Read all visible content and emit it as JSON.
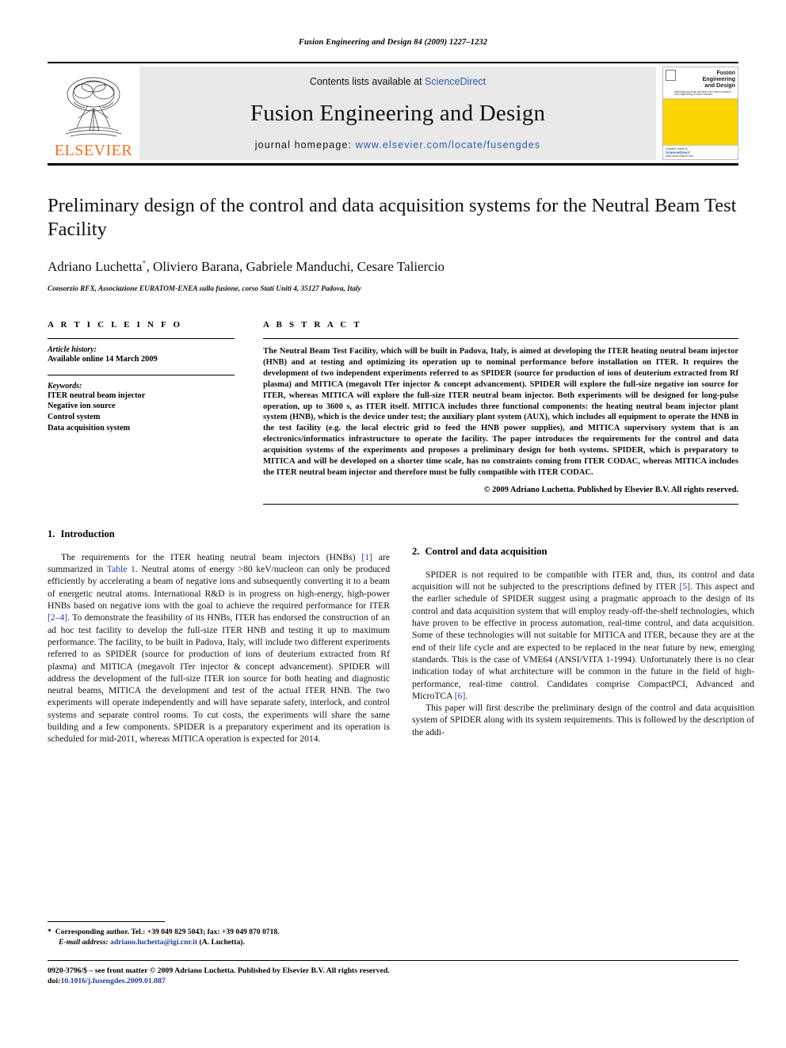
{
  "running_head": "Fusion Engineering and Design 84 (2009) 1227–1232",
  "masthead": {
    "publisher": "ELSEVIER",
    "contents_prefix": "Contents lists available at ",
    "contents_link": "ScienceDirect",
    "journal_name": "Fusion Engineering and Design",
    "homepage_prefix": "journal homepage: ",
    "homepage_url": "www.elsevier.com/locate/fusengdes",
    "cover": {
      "title_line1": "Fusion Engineering",
      "title_line2": "and Design",
      "subtitle": "International journal devoted to the fusion research and engineering of fusion reactors",
      "bottom_text": "Available online at",
      "bottom_mark": "ScienceDirect",
      "bottom_url": "www.sciencedirect.com"
    },
    "accent_orange": "#f27021",
    "cover_yellow": "#fbd603",
    "link_blue": "#2b59a8"
  },
  "article": {
    "title": "Preliminary design of the control and data acquisition systems for the Neutral Beam Test Facility",
    "authors": "Adriano Luchetta",
    "authors_rest": ", Oliviero Barana, Gabriele Manduchi, Cesare Taliercio",
    "corresponding_mark": "*",
    "affiliation": "Consorzio RFX, Associazione EURATOM-ENEA sulla fusione, corso Stati Uniti 4, 35127 Padova, Italy"
  },
  "article_info": {
    "heading": "A R T I C L E  I N F O",
    "history_label": "Article history:",
    "history_value": "Available online 14 March 2009",
    "keywords_label": "Keywords:",
    "keywords": [
      "ITER neutral beam injector",
      "Negative ion source",
      "Control system",
      "Data acquisition system"
    ]
  },
  "abstract": {
    "heading": "A B S T R A C T",
    "text": "The Neutral Beam Test Facility, which will be built in Padova, Italy, is aimed at developing the ITER heating neutral beam injector (HNB) and at testing and optimizing its operation up to nominal performance before installation on ITER. It requires the development of two independent experiments referred to as SPIDER (source for production of ions of deuterium extracted from Rf plasma) and MITICA (megavolt ITer injector & concept advancement). SPIDER will explore the full-size negative ion source for ITER, whereas MITICA will explore the full-size ITER neutral beam injector. Both experiments will be designed for long-pulse operation, up to 3600 s, as ITER itself. MITICA includes three functional components: the heating neutral beam injector plant system (HNB), which is the device under test; the auxiliary plant system (AUX), which includes all equipment to operate the HNB in the test facility (e.g. the local electric grid to feed the HNB power supplies), and MITICA supervisory system that is an electronics/informatics infrastructure to operate the facility. The paper introduces the requirements for the control and data acquisition systems of the experiments and proposes a preliminary design for both systems. SPIDER, which is preparatory to MITICA and will be developed on a shorter time scale, has no constraints coming from ITER CODAC, whereas MITICA includes the ITER neutral beam injector and therefore must be fully compatible with ITER CODAC.",
    "copyright": "© 2009 Adriano Luchetta. Published by Elsevier B.V. All rights reserved."
  },
  "body": {
    "section1_num": "1.",
    "section1_title": "Introduction",
    "p1_a": "The requirements for the ITER heating neutral beam injectors (HNBs) ",
    "p1_ref1": "[1]",
    "p1_b": " are summarized in ",
    "p1_table": "Table 1",
    "p1_c": ". Neutral atoms of energy >80 keV/nucleon can only be produced efficiently by accelerating a beam of negative ions and subsequently converting it to a beam of energetic neutral atoms. International R&D is in progress on high-energy, high-power HNBs based on negative ions with the goal to achieve the required performance for ITER ",
    "p1_ref2": "[2–4]",
    "p1_d": ". To demonstrate the feasibility of its HNBs, ITER has endorsed the construction of an ad hoc test facility to develop the full-size ITER HNB and testing it up to maximum performance. The facility, to be built in Padova, Italy, will include two different experiments referred to as SPIDER (source for production of ions of deuterium extracted from Rf plasma) and MITICA (megavolt ITer injector & concept advancement). SPIDER will address the development of the full-size ITER ion source for both heating and diagnostic neutral beams, MITICA the development and test of the actual ITER HNB. The two experiments will operate independently and will have separate safety, interlock, and control systems and separate control rooms. To cut costs, the experiments will share the same building and a few components. SPIDER is a preparatory experiment and its operation is scheduled for mid-2011, whereas MITICA operation is expected for 2014.",
    "section2_num": "2.",
    "section2_title": "Control and data acquisition",
    "p2_a": "SPIDER is not required to be compatible with ITER and, thus, its control and data acquisition will not be subjected to the prescriptions defined by ITER ",
    "p2_ref1": "[5]",
    "p2_b": ". This aspect and the earlier schedule of SPIDER suggest using a pragmatic approach to the design of its control and data acquisition system that will employ ready-off-the-shelf technologies, which have proven to be effective in process automation, real-time control, and data acquisition. Some of these technologies will not suitable for MITICA and ITER, because they are at the end of their life cycle and are expected to be replaced in the near future by new, emerging standards. This is the case of VME64 (ANSI/VITA 1-1994). Unfortunately there is no clear indication today of what architecture will be common in the future in the field of high-performance, real-time control. Candidates comprise CompactPCI, Advanced and MicroTCA ",
    "p2_ref2": "[6]",
    "p2_c": ".",
    "p3": "This paper will first describe the preliminary design of the control and data acquisition system of SPIDER along with its system requirements. This is followed by the description of the addi-"
  },
  "footnote": {
    "star": "*",
    "line1": "Corresponding author. Tel.: +39 049 829 5043; fax: +39 049 870 0718.",
    "email_label": "E-mail address:",
    "email": "adriano.luchetta@igi.cnr.it",
    "email_suffix": " (A. Luchetta)."
  },
  "page_footer": {
    "issn_line": "0920-3796/$ – see front matter © 2009 Adriano Luchetta. Published by Elsevier B.V. All rights reserved.",
    "doi_label": "doi:",
    "doi_value": "10.1016/j.fusengdes.2009.01.087"
  }
}
